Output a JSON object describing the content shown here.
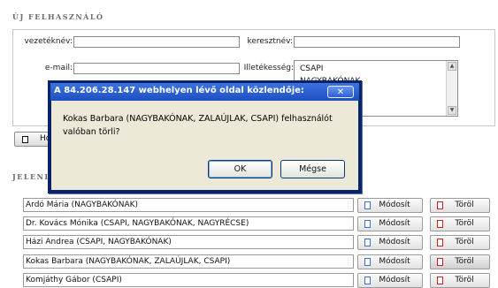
{
  "new_user_section": {
    "title": "ÚJ FELHASZNÁLÓ",
    "fields": {
      "lastname_label": "vezetéknév:",
      "lastname_value": "",
      "firstname_label": "keresztnév:",
      "firstname_value": "",
      "email_label": "e-mail:",
      "email_value": "",
      "jurisdiction_label": "Illetékesség:",
      "jurisdiction_options": [
        "CSAPI",
        "NAGYBAKÓNAK"
      ]
    },
    "add_button_label": "Ho"
  },
  "current_users_section": {
    "title": "JELENL"
  },
  "users": [
    {
      "name": "Ardó Mária (NAGYBAKÓNAK)",
      "modify_label": "Módosít",
      "delete_label": "Töröl"
    },
    {
      "name": "Dr. Kovács Mónika (CSAPI, NAGYBAKÓNAK, NAGYRÉCSE)",
      "modify_label": "Módosít",
      "delete_label": "Töröl"
    },
    {
      "name": "Házi Andrea (CSAPI, NAGYBAKÓNAK)",
      "modify_label": "Módosít",
      "delete_label": "Töröl"
    },
    {
      "name": "Kokas Barbara (NAGYBAKÓNAK, ZALAÚJLAK, CSAPI)",
      "modify_label": "Módosít",
      "delete_label": "Töröl"
    },
    {
      "name": "Komjáthy Gábor (CSAPI)",
      "modify_label": "Módosít",
      "delete_label": "Töröl"
    }
  ],
  "dialog": {
    "title": "A 84.206.28.147 webhelyen lévő oldal közlendője:",
    "close_label": "✕",
    "message": "Kokas Barbara (NAGYBAKÓNAK, ZALAÚJLAK, CSAPI) felhasználót valóban törli?",
    "ok_label": "OK",
    "cancel_label": "Mégse"
  },
  "colors": {
    "dialog_title_bar": "#2c5fcf",
    "dialog_client": "#ece9d8",
    "modify_icon": "#3b6fd1",
    "delete_icon": "#d11f1f"
  },
  "icons": {
    "modify": "edit-icon",
    "delete": "delete-icon",
    "close": "close-icon"
  }
}
